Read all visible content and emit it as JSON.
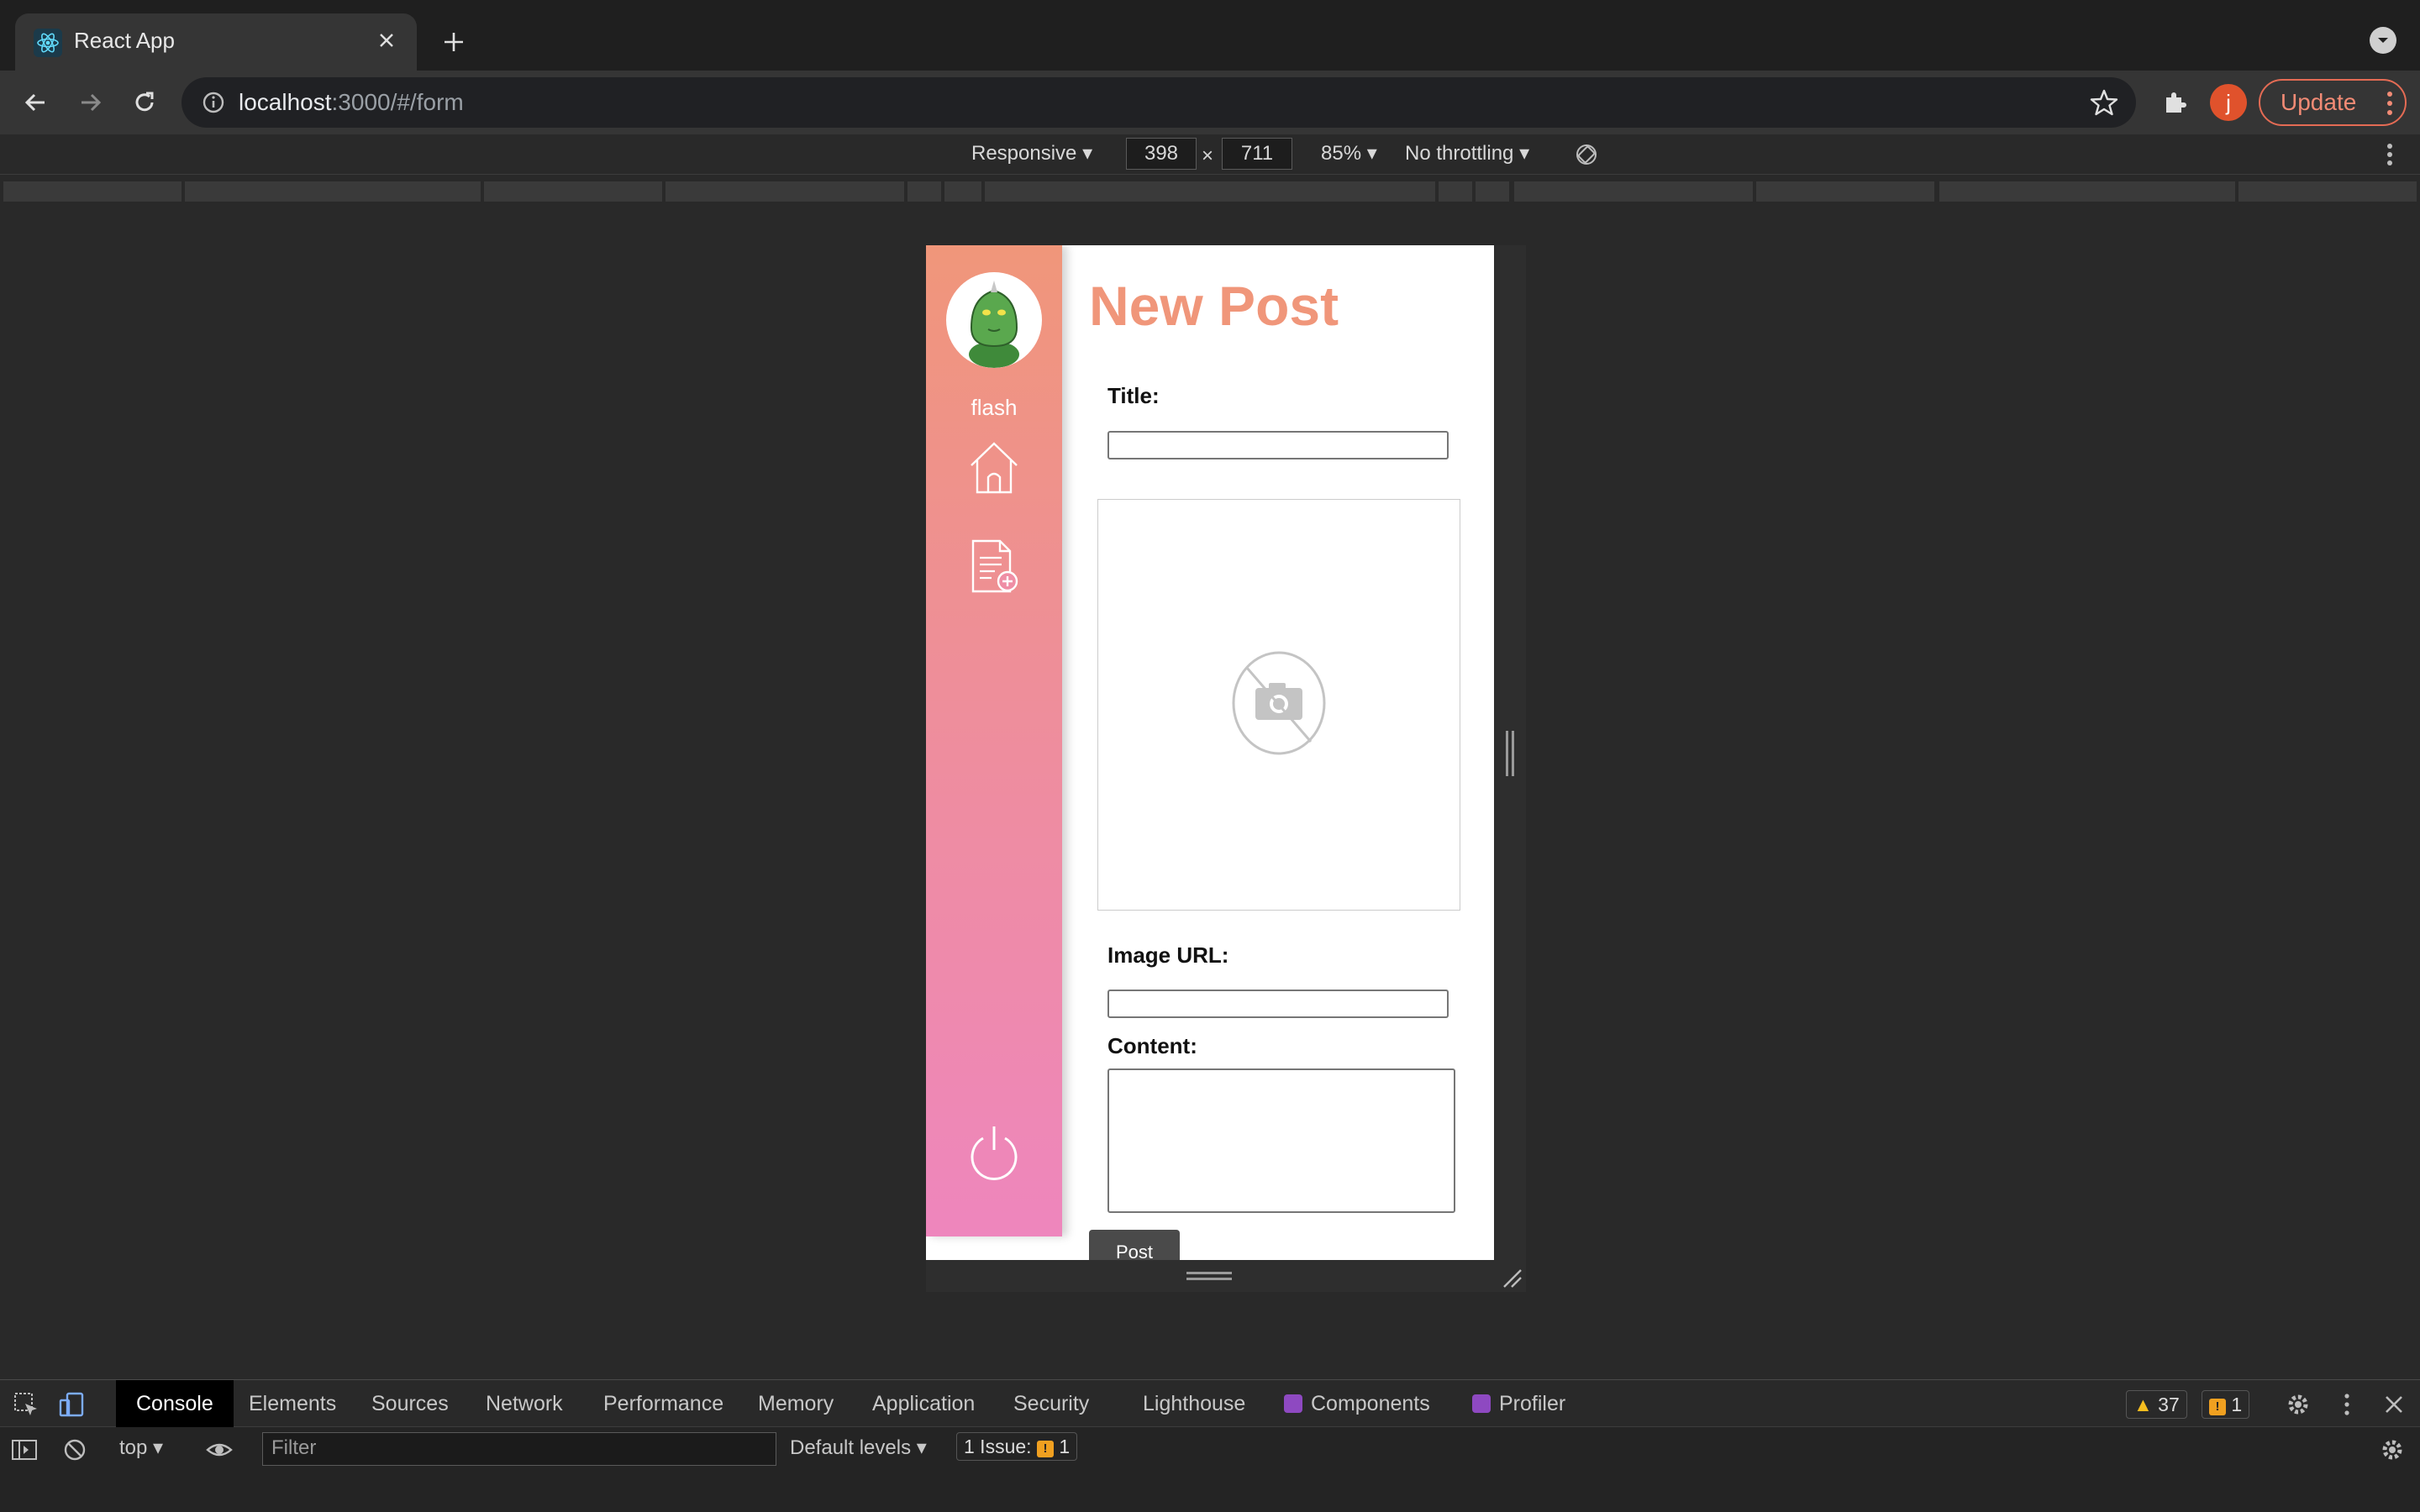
{
  "browser": {
    "tab_title": "React App",
    "url_host": "localhost",
    "url_path": ":3000/#/form",
    "profile_initial": "j",
    "update_label": "Update"
  },
  "device_toolbar": {
    "device": "Responsive ▾",
    "width": "398",
    "height": "711",
    "times": "×",
    "zoom": "85% ▾",
    "throttling": "No throttling ▾"
  },
  "app": {
    "username": "flash",
    "page_title": "New Post",
    "title_label": "Title:",
    "image_url_label": "Image URL:",
    "content_label": "Content:",
    "post_button": "Post",
    "colors": {
      "accent": "#f0967a",
      "sidebar_top": "#f0967a",
      "sidebar_bottom": "#ee86bd"
    }
  },
  "devtools": {
    "tabs": [
      "Console",
      "Elements",
      "Sources",
      "Network",
      "Performance",
      "Memory",
      "Application",
      "Security",
      "Lighthouse",
      "Components",
      "Profiler"
    ],
    "active_tab": "Console",
    "warnings_count": "37",
    "issues_count": "1",
    "context": "top ▾",
    "filter_placeholder": "Filter",
    "levels": "Default levels ▾",
    "issue_summary": "1 Issue:",
    "issue_summary_count": "1"
  }
}
